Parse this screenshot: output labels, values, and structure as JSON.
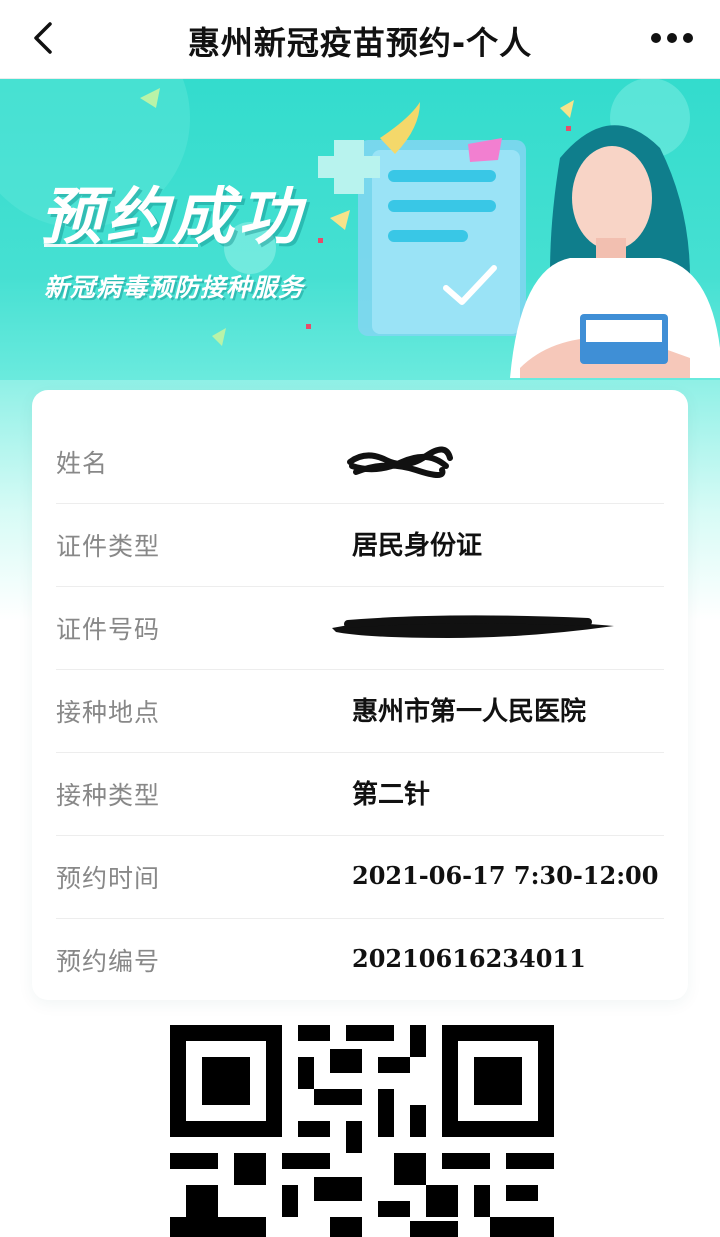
{
  "nav": {
    "title": "惠州新冠疫苗预约-个人",
    "back_icon": "chevron-left-icon",
    "more_icon": "more-dots-icon"
  },
  "banner": {
    "headline": "预约成功",
    "subtitle": "新冠病毒预防接种服务"
  },
  "info": {
    "rows": [
      {
        "label": "姓名",
        "value": "",
        "redacted": true
      },
      {
        "label": "证件类型",
        "value": "居民身份证"
      },
      {
        "label": "证件号码",
        "value": "",
        "redacted": true
      },
      {
        "label": "接种地点",
        "value": "惠州市第一人民医院"
      },
      {
        "label": "接种类型",
        "value": "第二针"
      },
      {
        "label": "预约时间",
        "value": "2021-06-17 7:30-12:00"
      },
      {
        "label": "预约编号",
        "value": "20210616234011"
      }
    ]
  },
  "colors": {
    "banner_top": "#33dccd",
    "banner_bottom": "#7ff0e4",
    "label_text": "#888888",
    "value_text": "#111111"
  }
}
